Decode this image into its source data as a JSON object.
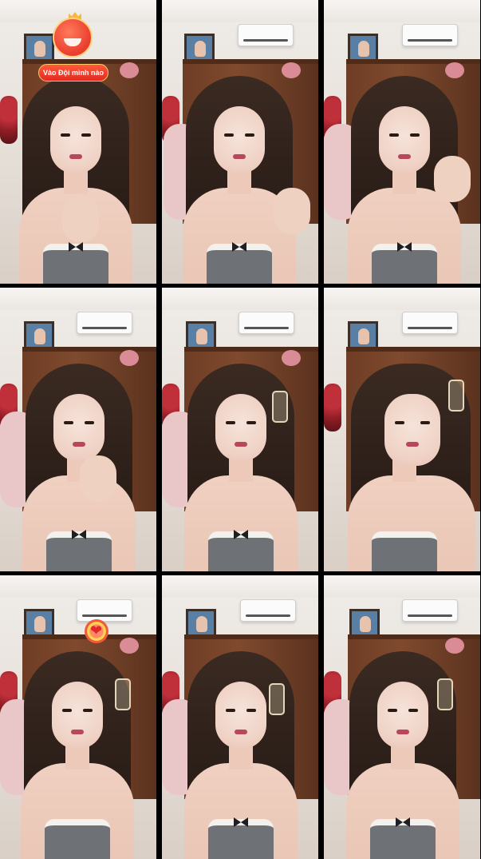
{
  "layout": {
    "rows": 3,
    "columns": 3
  },
  "tiles": [
    {
      "badge": {
        "label": "Vào Đội mình nào",
        "icon": "mascot-heart-icon"
      }
    },
    {},
    {},
    {},
    {},
    {},
    {
      "sticker": "heart-sticker-icon"
    },
    {},
    {}
  ],
  "colors": {
    "background": "#000000",
    "badge_red": "#e02b20",
    "badge_border": "#ffc86a"
  }
}
